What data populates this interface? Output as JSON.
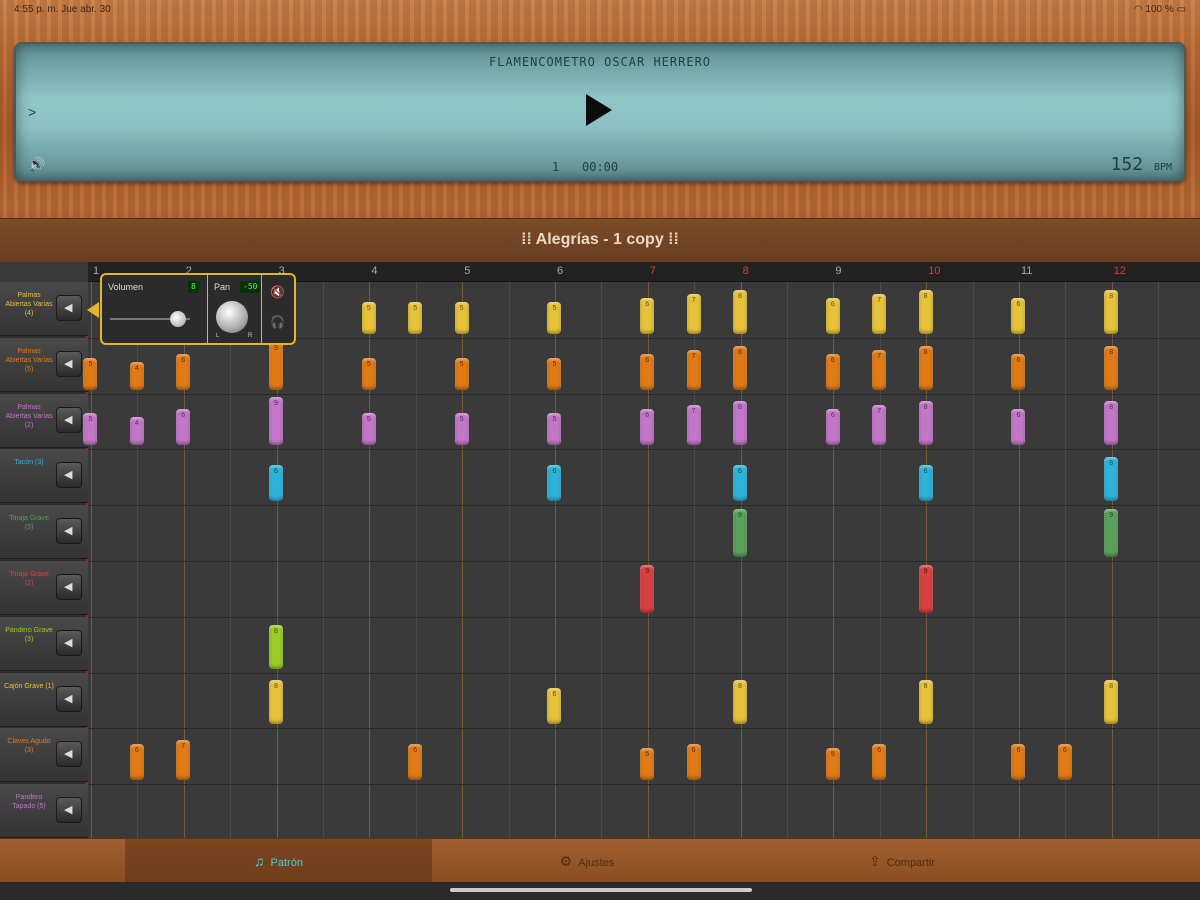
{
  "status": {
    "time": "4:55 p. m.   Jue abr. 30",
    "battery": "100 %"
  },
  "lcd": {
    "title": "FLAMENCOMETRO OSCAR HERRERO",
    "chevron": ">",
    "bar": "1",
    "time": "00:00",
    "bpm_value": "152",
    "bpm_unit": "BPM"
  },
  "pattern": {
    "title": "Alegrías - 1 copy"
  },
  "beats": [
    "1",
    "2",
    "3",
    "4",
    "5",
    "6",
    "7",
    "8",
    "9",
    "10",
    "11",
    "12"
  ],
  "accent_beats": [
    7,
    8,
    10,
    12
  ],
  "tracks": [
    {
      "name": "Palmas Abiertas Varias (4)",
      "color": "#e6c23a"
    },
    {
      "name": "Palmas Abiertas Varias (5)",
      "color": "#e07a16"
    },
    {
      "name": "Palmas Abiertas Varias (2)",
      "color": "#c276c8"
    },
    {
      "name": "Tacón (3)",
      "color": "#2fb2d8"
    },
    {
      "name": "Tinaja Grave (3)",
      "color": "#5aa05a"
    },
    {
      "name": "Tinaja Grave (2)",
      "color": "#d84040"
    },
    {
      "name": "Pandero Grave (3)",
      "color": "#9acc2a"
    },
    {
      "name": "Cajón Grave (1)",
      "color": "#e6c23a"
    },
    {
      "name": "Claves Agudo (3)",
      "color": "#e07a16"
    },
    {
      "name": "Pandero Tapado (5)",
      "color": "#c276c8"
    }
  ],
  "notes": [
    {
      "t": 0,
      "x": 1.0,
      "v": "5"
    },
    {
      "t": 0,
      "x": 1.5,
      "v": "5"
    },
    {
      "t": 0,
      "x": 2.0,
      "v": "5"
    },
    {
      "t": 0,
      "x": 3.0,
      "v": "5"
    },
    {
      "t": 0,
      "x": 4.0,
      "v": "6"
    },
    {
      "t": 0,
      "x": 4.5,
      "v": "7"
    },
    {
      "t": 0,
      "x": 5.0,
      "v": "8"
    },
    {
      "t": 0,
      "x": 6.0,
      "v": "6"
    },
    {
      "t": 0,
      "x": 6.5,
      "v": "7"
    },
    {
      "t": 0,
      "x": 7.0,
      "v": "8"
    },
    {
      "t": 0,
      "x": 8.0,
      "v": "6"
    },
    {
      "t": 0,
      "x": 9.0,
      "v": "8"
    },
    {
      "t": 1,
      "x": -2.0,
      "v": "5"
    },
    {
      "t": 1,
      "x": -1.5,
      "v": "4"
    },
    {
      "t": 1,
      "x": -1.0,
      "v": "6"
    },
    {
      "t": 1,
      "x": 0.0,
      "v": "9"
    },
    {
      "t": 1,
      "x": 1.0,
      "v": "5"
    },
    {
      "t": 1,
      "x": 2.0,
      "v": "5"
    },
    {
      "t": 1,
      "x": 3.0,
      "v": "5"
    },
    {
      "t": 1,
      "x": 4.0,
      "v": "6"
    },
    {
      "t": 1,
      "x": 4.5,
      "v": "7"
    },
    {
      "t": 1,
      "x": 5.0,
      "v": "8"
    },
    {
      "t": 1,
      "x": 6.0,
      "v": "6"
    },
    {
      "t": 1,
      "x": 6.5,
      "v": "7"
    },
    {
      "t": 1,
      "x": 7.0,
      "v": "8"
    },
    {
      "t": 1,
      "x": 8.0,
      "v": "6"
    },
    {
      "t": 1,
      "x": 9.0,
      "v": "8"
    },
    {
      "t": 2,
      "x": -2.0,
      "v": "5"
    },
    {
      "t": 2,
      "x": -1.5,
      "v": "4"
    },
    {
      "t": 2,
      "x": -1.0,
      "v": "6"
    },
    {
      "t": 2,
      "x": 0.0,
      "v": "9"
    },
    {
      "t": 2,
      "x": 1.0,
      "v": "5"
    },
    {
      "t": 2,
      "x": 2.0,
      "v": "5"
    },
    {
      "t": 2,
      "x": 3.0,
      "v": "5"
    },
    {
      "t": 2,
      "x": 4.0,
      "v": "6"
    },
    {
      "t": 2,
      "x": 4.5,
      "v": "7"
    },
    {
      "t": 2,
      "x": 5.0,
      "v": "8"
    },
    {
      "t": 2,
      "x": 6.0,
      "v": "6"
    },
    {
      "t": 2,
      "x": 6.5,
      "v": "7"
    },
    {
      "t": 2,
      "x": 7.0,
      "v": "8"
    },
    {
      "t": 2,
      "x": 8.0,
      "v": "6"
    },
    {
      "t": 2,
      "x": 9.0,
      "v": "8"
    },
    {
      "t": 3,
      "x": 0.0,
      "v": "6"
    },
    {
      "t": 3,
      "x": 3.0,
      "v": "6"
    },
    {
      "t": 3,
      "x": 5.0,
      "v": "6"
    },
    {
      "t": 3,
      "x": 7.0,
      "v": "6"
    },
    {
      "t": 3,
      "x": 9.0,
      "v": "8"
    },
    {
      "t": 4,
      "x": 5.0,
      "v": "9"
    },
    {
      "t": 4,
      "x": 9.0,
      "v": "9"
    },
    {
      "t": 5,
      "x": 4.0,
      "v": "9"
    },
    {
      "t": 5,
      "x": 7.0,
      "v": "9"
    },
    {
      "t": 6,
      "x": 0.0,
      "v": "8"
    },
    {
      "t": 7,
      "x": 0.0,
      "v": "8"
    },
    {
      "t": 7,
      "x": 3.0,
      "v": "6"
    },
    {
      "t": 7,
      "x": 5.0,
      "v": "8"
    },
    {
      "t": 7,
      "x": 7.0,
      "v": "8"
    },
    {
      "t": 7,
      "x": 9.0,
      "v": "8"
    },
    {
      "t": 8,
      "x": -1.5,
      "v": "6"
    },
    {
      "t": 8,
      "x": -1.0,
      "v": "7"
    },
    {
      "t": 8,
      "x": 1.5,
      "v": "6"
    },
    {
      "t": 8,
      "x": 4.0,
      "v": "5"
    },
    {
      "t": 8,
      "x": 4.5,
      "v": "6"
    },
    {
      "t": 8,
      "x": 6.0,
      "v": "5"
    },
    {
      "t": 8,
      "x": 6.5,
      "v": "6"
    },
    {
      "t": 8,
      "x": 8.0,
      "v": "6"
    },
    {
      "t": 8,
      "x": 8.5,
      "v": "6"
    }
  ],
  "popover": {
    "volume_label": "Volumen",
    "volume_value": "8",
    "volume_level": 0.85,
    "pan_label": "Pan",
    "pan_value": "-50",
    "pan_left": "L",
    "pan_right": "R"
  },
  "tabs": [
    {
      "label": "Patrón",
      "icon": "music-note-icon",
      "active": true
    },
    {
      "label": "Ajustes",
      "icon": "gear-icon",
      "active": false
    },
    {
      "label": "Compartir",
      "icon": "share-icon",
      "active": false
    }
  ]
}
